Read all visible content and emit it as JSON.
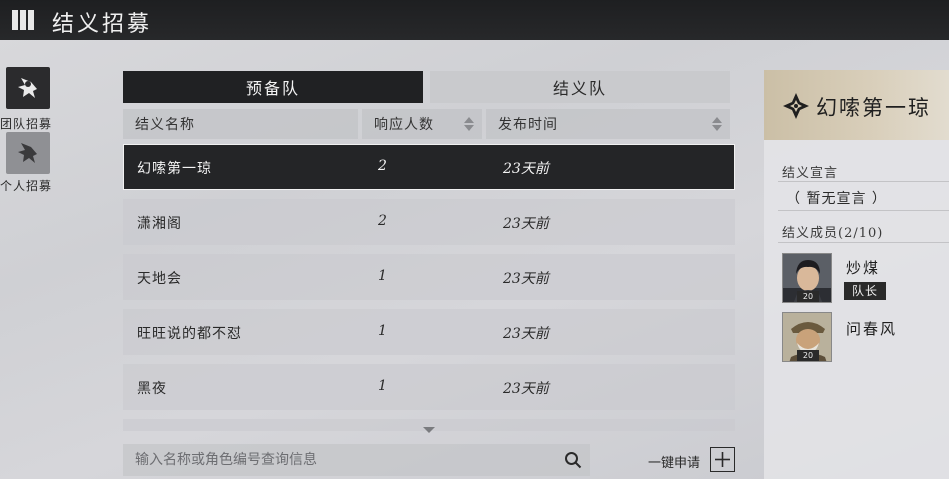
{
  "header": {
    "title": "结义招募"
  },
  "side_nav": [
    {
      "label": "团队招募",
      "icon": "team-recruit-icon",
      "active": true
    },
    {
      "label": "个人招募",
      "icon": "personal-recruit-icon",
      "active": false
    }
  ],
  "tabs": [
    {
      "label": "预备队",
      "active": true
    },
    {
      "label": "结义队",
      "active": false
    }
  ],
  "columns": {
    "name": "结义名称",
    "count": "响应人数",
    "time": "发布时间"
  },
  "rows": [
    {
      "name": "幻嗦第一琼",
      "count": "2",
      "time": "23天前",
      "selected": true
    },
    {
      "name": "潇湘阁",
      "count": "2",
      "time": "23天前",
      "selected": false
    },
    {
      "name": "天地会",
      "count": "1",
      "time": "23天前",
      "selected": false
    },
    {
      "name": "旺旺说的都不怼",
      "count": "1",
      "time": "23天前",
      "selected": false
    },
    {
      "name": "黑夜",
      "count": "1",
      "time": "23天前",
      "selected": false
    }
  ],
  "search": {
    "placeholder": "输入名称或角色编号查询信息",
    "value": ""
  },
  "apply": {
    "label": "一键申请"
  },
  "detail": {
    "title": "幻嗦第一琼",
    "declaration_label": "结义宣言",
    "declaration": "（ 暂无宣言 ）",
    "members_label": "结义成员(2/10)",
    "members": [
      {
        "name": "炒煤",
        "level": "20",
        "role": "队长"
      },
      {
        "name": "问春风",
        "level": "20",
        "role": ""
      }
    ]
  },
  "colors": {
    "topbar": "#1e1f21",
    "selected_row": "#242527",
    "panel_head": "#d4c8b0"
  }
}
